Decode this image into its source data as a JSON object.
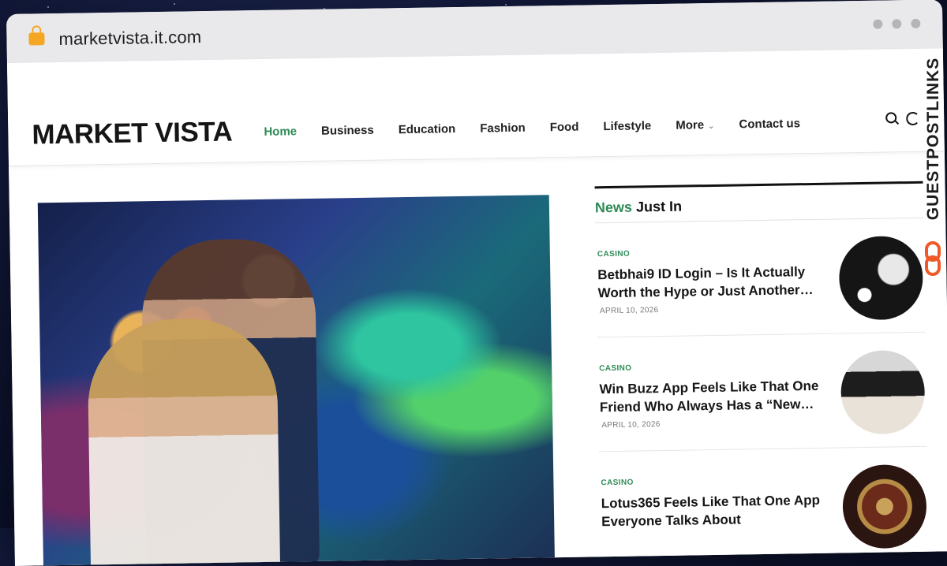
{
  "browser": {
    "url": "marketvista.it.com"
  },
  "site": {
    "logo": "MARKET VISTA",
    "nav": [
      {
        "label": "Home",
        "active": true
      },
      {
        "label": "Business"
      },
      {
        "label": "Education"
      },
      {
        "label": "Fashion"
      },
      {
        "label": "Food"
      },
      {
        "label": "Lifestyle"
      },
      {
        "label": "More"
      },
      {
        "label": "Contact us"
      }
    ],
    "icons": [
      "search-icon",
      "moon-icon"
    ]
  },
  "sidebar": {
    "title_accent": "News",
    "title_rest": " Just In",
    "posts": [
      {
        "category": "CASINO",
        "title": "Betbhai9 ID Login – Is It Actually Worth the Hype or Just Another…",
        "date": "APRIL 10, 2026"
      },
      {
        "category": "CASINO",
        "title": "Win Buzz App Feels Like That One Friend Who Always Has a “New…",
        "date": "APRIL 10, 2026"
      },
      {
        "category": "CASINO",
        "title": "Lotus365 Feels Like That One App Everyone Talks About",
        "date": ""
      }
    ]
  },
  "watermark": {
    "text": "GUESTPOSTLINKS"
  },
  "colors": {
    "accent": "#2e8b57",
    "lock": "#f5a623",
    "watermark_link": "#f05a28"
  }
}
